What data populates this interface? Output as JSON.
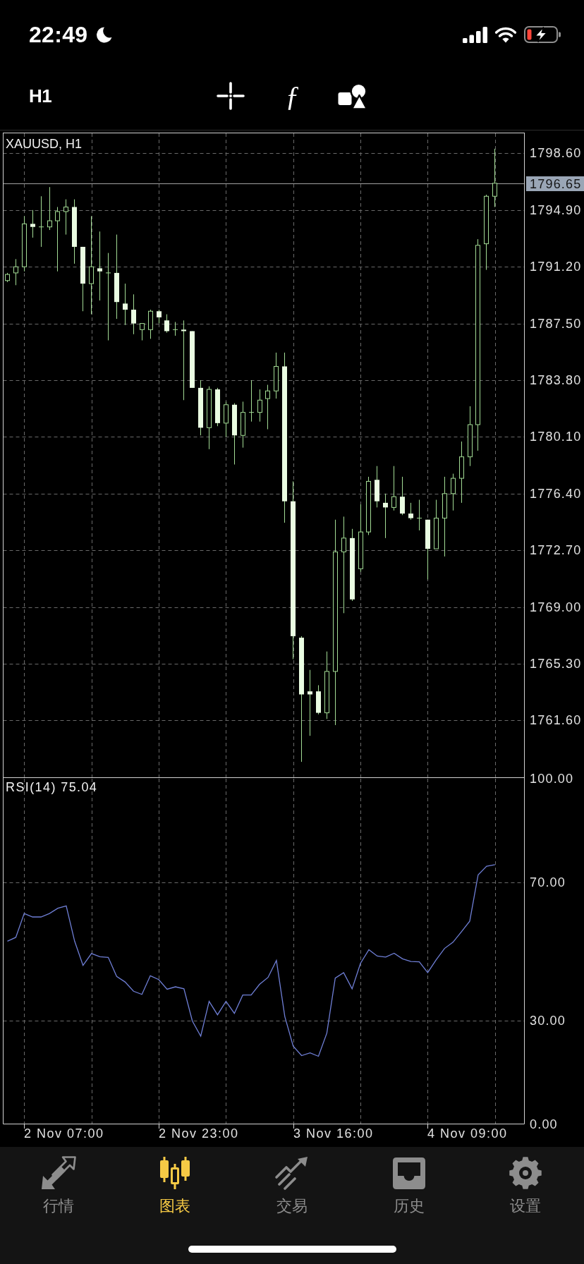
{
  "status_bar": {
    "time": "22:49"
  },
  "toolbar": {
    "timeframe": "H1",
    "function_button": "ƒ"
  },
  "price_chart": {
    "chart_data": {
      "type": "candlestick",
      "title": "XAUUSD, H1",
      "categories": [
        null,
        null,
        null,
        null,
        null,
        null,
        null,
        null,
        null,
        null,
        null,
        null,
        null,
        null,
        null,
        null,
        null,
        null,
        null,
        null,
        null,
        null,
        null,
        null,
        null,
        null,
        null,
        null,
        null,
        null,
        null,
        null,
        null,
        null,
        null,
        null,
        null,
        null,
        null,
        null,
        null,
        null,
        null,
        null,
        null,
        null,
        null,
        null,
        null,
        null,
        null,
        null,
        null,
        null,
        null,
        null,
        null,
        null,
        null,
        null,
        null,
        null
      ],
      "ohlc": [
        [
          1790.3,
          1790.8,
          1790.2,
          1790.7
        ],
        [
          1790.8,
          1791.7,
          1790.0,
          1791.2
        ],
        [
          1791.2,
          1794.5,
          1790.9,
          1794.0
        ],
        [
          1794.0,
          1794.9,
          1793.1,
          1793.8
        ],
        [
          1793.8,
          1795.8,
          1792.5,
          1793.8
        ],
        [
          1793.8,
          1796.4,
          1793.6,
          1794.2
        ],
        [
          1794.2,
          1795.1,
          1790.9,
          1794.8
        ],
        [
          1794.8,
          1795.6,
          1793.3,
          1795.1
        ],
        [
          1795.1,
          1795.6,
          1791.4,
          1792.5
        ],
        [
          1792.5,
          1792.5,
          1788.3,
          1790.1
        ],
        [
          1790.1,
          1794.5,
          1788.1,
          1791.2
        ],
        [
          1791.1,
          1793.5,
          1789.0,
          1790.9
        ],
        [
          1790.8,
          1792.1,
          1786.4,
          1790.8
        ],
        [
          1790.8,
          1793.3,
          1787.8,
          1788.9
        ],
        [
          1788.8,
          1790.1,
          1787.4,
          1788.4
        ],
        [
          1788.4,
          1789.4,
          1786.8,
          1787.5
        ],
        [
          1787.1,
          1787.5,
          1786.4,
          1787.5
        ],
        [
          1787.1,
          1788.4,
          1786.5,
          1788.3
        ],
        [
          1788.3,
          1788.4,
          1787.5,
          1787.9
        ],
        [
          1787.7,
          1788.1,
          1786.9,
          1787.0
        ],
        [
          1787.1,
          1787.6,
          1786.7,
          1787.1
        ],
        [
          1787.1,
          1787.7,
          1782.5,
          1787.0
        ],
        [
          1787.0,
          1787.0,
          1783.3,
          1783.3
        ],
        [
          1783.3,
          1783.8,
          1780.2,
          1780.7
        ],
        [
          1780.7,
          1783.4,
          1779.3,
          1783.2
        ],
        [
          1783.2,
          1783.3,
          1780.8,
          1781.0
        ],
        [
          1781.0,
          1782.4,
          1780.1,
          1782.2
        ],
        [
          1782.2,
          1782.3,
          1778.3,
          1780.2
        ],
        [
          1780.2,
          1782.4,
          1779.4,
          1781.7
        ],
        [
          1781.7,
          1783.8,
          1781.1,
          1781.7
        ],
        [
          1781.7,
          1783.2,
          1781.1,
          1782.5
        ],
        [
          1782.6,
          1783.5,
          1780.6,
          1783.1
        ],
        [
          1783.1,
          1785.6,
          1782.6,
          1784.7
        ],
        [
          1784.7,
          1785.6,
          1774.5,
          1775.9
        ],
        [
          1775.9,
          1777.2,
          1765.6,
          1767.1
        ],
        [
          1767.0,
          1767.1,
          1758.9,
          1763.3
        ],
        [
          1763.5,
          1764.9,
          1760.6,
          1763.3
        ],
        [
          1763.5,
          1763.9,
          1762.0,
          1762.1
        ],
        [
          1762.1,
          1766.1,
          1761.7,
          1764.8
        ],
        [
          1764.8,
          1774.7,
          1761.3,
          1772.6
        ],
        [
          1772.6,
          1774.9,
          1768.6,
          1773.5
        ],
        [
          1773.5,
          1774.1,
          1769.4,
          1769.5
        ],
        [
          1771.5,
          1775.7,
          1771.3,
          1773.9
        ],
        [
          1773.9,
          1777.5,
          1773.7,
          1777.2
        ],
        [
          1777.3,
          1778.2,
          1775.5,
          1775.9
        ],
        [
          1775.8,
          1776.4,
          1773.5,
          1775.5
        ],
        [
          1775.5,
          1778.2,
          1775.3,
          1776.2
        ],
        [
          1776.2,
          1777.5,
          1775.0,
          1775.1
        ],
        [
          1775.1,
          1775.8,
          1774.7,
          1774.8
        ],
        [
          1774.8,
          1776.0,
          1774.0,
          1774.8
        ],
        [
          1774.7,
          1774.7,
          1770.8,
          1772.8
        ],
        [
          1772.8,
          1776.0,
          1772.8,
          1774.8
        ],
        [
          1774.8,
          1777.5,
          1772.3,
          1776.4
        ],
        [
          1776.4,
          1777.7,
          1775.3,
          1777.4
        ],
        [
          1777.4,
          1779.8,
          1775.8,
          1778.8
        ],
        [
          1778.8,
          1782.1,
          1778.2,
          1780.9
        ],
        [
          1780.9,
          1793.0,
          1779.2,
          1792.6
        ],
        [
          1792.7,
          1795.9,
          1791.0,
          1795.8
        ],
        [
          1795.8,
          1798.9,
          1795.1,
          1796.65
        ],
        null,
        null,
        null
      ],
      "ylim": [
        1757.87,
        1799.93
      ],
      "yticks": [
        {
          "value": 1798.6,
          "label": "1798.60"
        },
        {
          "value": 1794.9,
          "label": "1794.90"
        },
        {
          "value": 1791.2,
          "label": "1791.20"
        },
        {
          "value": 1787.5,
          "label": "1787.50"
        },
        {
          "value": 1783.8,
          "label": "1783.80"
        },
        {
          "value": 1780.1,
          "label": "1780.10"
        },
        {
          "value": 1776.4,
          "label": "1776.40"
        },
        {
          "value": 1772.7,
          "label": "1772.70"
        },
        {
          "value": 1769.0,
          "label": "1769.00"
        },
        {
          "value": 1765.3,
          "label": "1765.30"
        },
        {
          "value": 1761.6,
          "label": "1761.60"
        }
      ],
      "grid": true,
      "ref_lines": [
        {
          "axis": "y",
          "value": 1796.65,
          "label": "1796.65"
        }
      ]
    }
  },
  "rsi_chart": {
    "chart_data": {
      "type": "line",
      "title": "RSI(14) 75.04",
      "categories": [
        null,
        null,
        null,
        null,
        null,
        null,
        null,
        null,
        null,
        null,
        null,
        null,
        null,
        null,
        null,
        null,
        null,
        null,
        null,
        null,
        null,
        null,
        null,
        null,
        null,
        null,
        null,
        null,
        null,
        null,
        null,
        null,
        null,
        null,
        null,
        null,
        null,
        null,
        null,
        null,
        null,
        null,
        null,
        null,
        null,
        null,
        null,
        null,
        null,
        null,
        null,
        null,
        null,
        null,
        null,
        null,
        null,
        null,
        null,
        null,
        null,
        null
      ],
      "series": [
        {
          "color": "#6f7fd6",
          "values": [
            52.9,
            54.0,
            60.9,
            59.9,
            59.9,
            60.9,
            62.4,
            63.1,
            52.9,
            45.9,
            49.3,
            48.4,
            48.2,
            42.7,
            41.1,
            38.4,
            37.5,
            42.9,
            41.8,
            39.0,
            39.7,
            39.1,
            29.8,
            25.4,
            35.5,
            31.6,
            35.5,
            32.0,
            37.3,
            37.3,
            40.4,
            42.4,
            47.3,
            31.1,
            22.5,
            19.8,
            20.6,
            19.6,
            26.3,
            42.2,
            43.8,
            39.1,
            46.5,
            50.4,
            48.6,
            48.3,
            49.4,
            47.8,
            47.0,
            46.9,
            43.8,
            47.5,
            50.8,
            52.6,
            55.6,
            58.7,
            72.1,
            74.6,
            75.04,
            null,
            null,
            null
          ]
        }
      ],
      "ylim": [
        0,
        100
      ],
      "yticks": [
        {
          "value": 100,
          "label": "100.00"
        },
        {
          "value": 70,
          "label": "70.00"
        },
        {
          "value": 30,
          "label": "30.00"
        },
        {
          "value": 0,
          "label": "0.00"
        }
      ],
      "grid": true
    }
  },
  "time_axis": {
    "labels": [
      "2 Nov 07:00",
      "2 Nov 23:00",
      "3 Nov 16:00",
      "4 Nov 09:00"
    ]
  },
  "tab_bar": {
    "tabs": [
      {
        "label": "行情",
        "selected": false
      },
      {
        "label": "图表",
        "selected": true
      },
      {
        "label": "交易",
        "selected": false
      },
      {
        "label": "历史",
        "selected": false
      },
      {
        "label": "设置",
        "selected": false
      }
    ]
  }
}
